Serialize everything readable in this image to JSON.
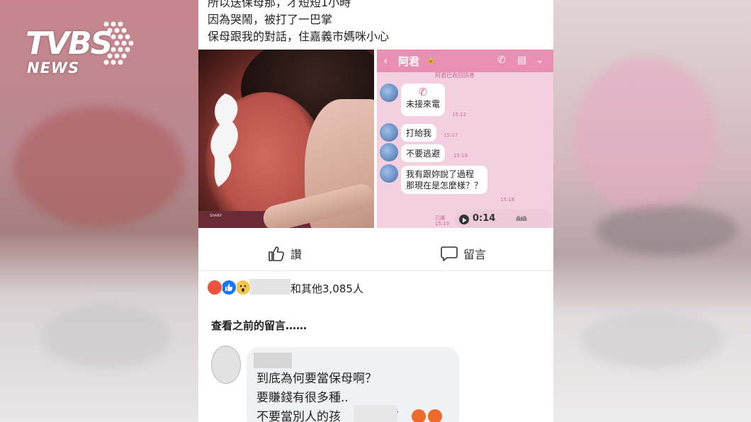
{
  "watermark": {
    "brand": "TVBS",
    "sub": "NEWS"
  },
  "post": {
    "lines": [
      "所以送保母那，才短短1小時",
      "因為哭鬧，被打了一巴掌",
      "保母跟我的對話，住嘉義市媽咪小心"
    ]
  },
  "photo": {
    "watermark": "SHARP"
  },
  "chat": {
    "contact": "阿君",
    "system_note": "阿君已收回訊息",
    "messages": [
      {
        "text": "未接來電",
        "time": "15:12"
      },
      {
        "text": "打給我",
        "time": "15:17"
      },
      {
        "text": "不要逃避",
        "time": "15:18"
      },
      {
        "line1": "我有跟妳說了過程",
        "line2": "那現在是怎麼樣？？",
        "time": "15:18"
      }
    ],
    "voice": {
      "duration": "0:14",
      "read": "已讀",
      "time": "15:19"
    }
  },
  "actions": {
    "like": "讚",
    "comment": "留言"
  },
  "reactions": {
    "summary": "和其他3,085人"
  },
  "comments": {
    "view_previous": "查看之前的留言……",
    "first": {
      "line1": "到底為何要當保母啊？",
      "line2": "要賺錢有很多種..",
      "line3_start": "不要當別人的孩",
      "line3_end": "了"
    }
  },
  "colors": {
    "chat_header": "#ea8fb3",
    "chat_bg": "#f4cfe0",
    "fb_like_blue": "#1877f2"
  }
}
